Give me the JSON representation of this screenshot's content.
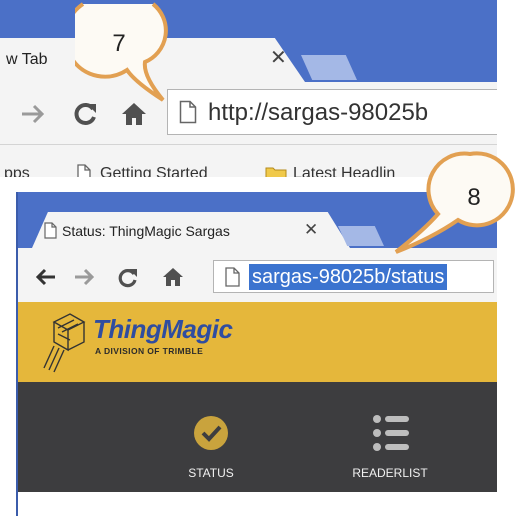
{
  "colors": {
    "chrome_blue": "#4b70c7",
    "toolbar_gray": "#f4f4f4",
    "selection_blue": "#3b73cf",
    "thingmagic_gold": "#e5b73b",
    "thingmagic_blue": "#2f4da0",
    "nav_dark": "#3d3d3f",
    "callout_orange": "#e2a052"
  },
  "browser_top": {
    "tab_title": "w Tab",
    "close_glyph": "✕",
    "address_url": "http://sargas-98025b",
    "bookmarks": [
      {
        "label": "pps",
        "icon": "none"
      },
      {
        "label": "Getting Started",
        "icon": "page-icon"
      },
      {
        "label": "Latest Headlin",
        "icon": "folder-icon"
      }
    ]
  },
  "browser_bottom": {
    "tab_title": "Status: ThingMagic Sargas",
    "close_glyph": "✕",
    "address_url": "sargas-98025b/status"
  },
  "thingmagic": {
    "brand_name": "ThingMagic",
    "tagline": "A DIVISION OF TRIMBLE",
    "nav_items": [
      {
        "label": "STATUS",
        "icon": "checkmark-icon"
      },
      {
        "label": "READERLIST",
        "icon": "list-icon"
      }
    ]
  },
  "callouts": [
    {
      "number": "7"
    },
    {
      "number": "8"
    }
  ]
}
